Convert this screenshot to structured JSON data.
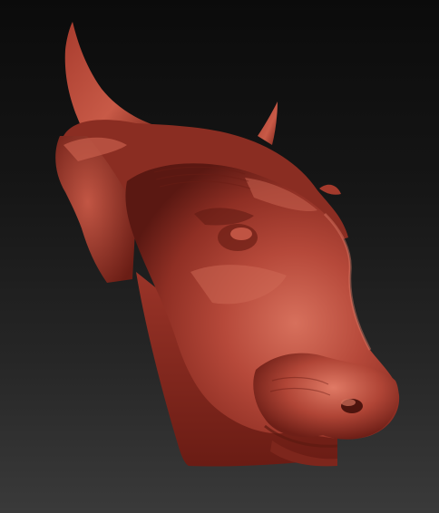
{
  "viewport": {
    "model_name": "bull-head-sculpt",
    "colors": {
      "background_top": "#0b0b0b",
      "background_bottom": "#3a3a3a",
      "matcap_base": "#8f2f24",
      "matcap_highlight": "#d56a57",
      "matcap_shadow": "#4a120d"
    }
  }
}
